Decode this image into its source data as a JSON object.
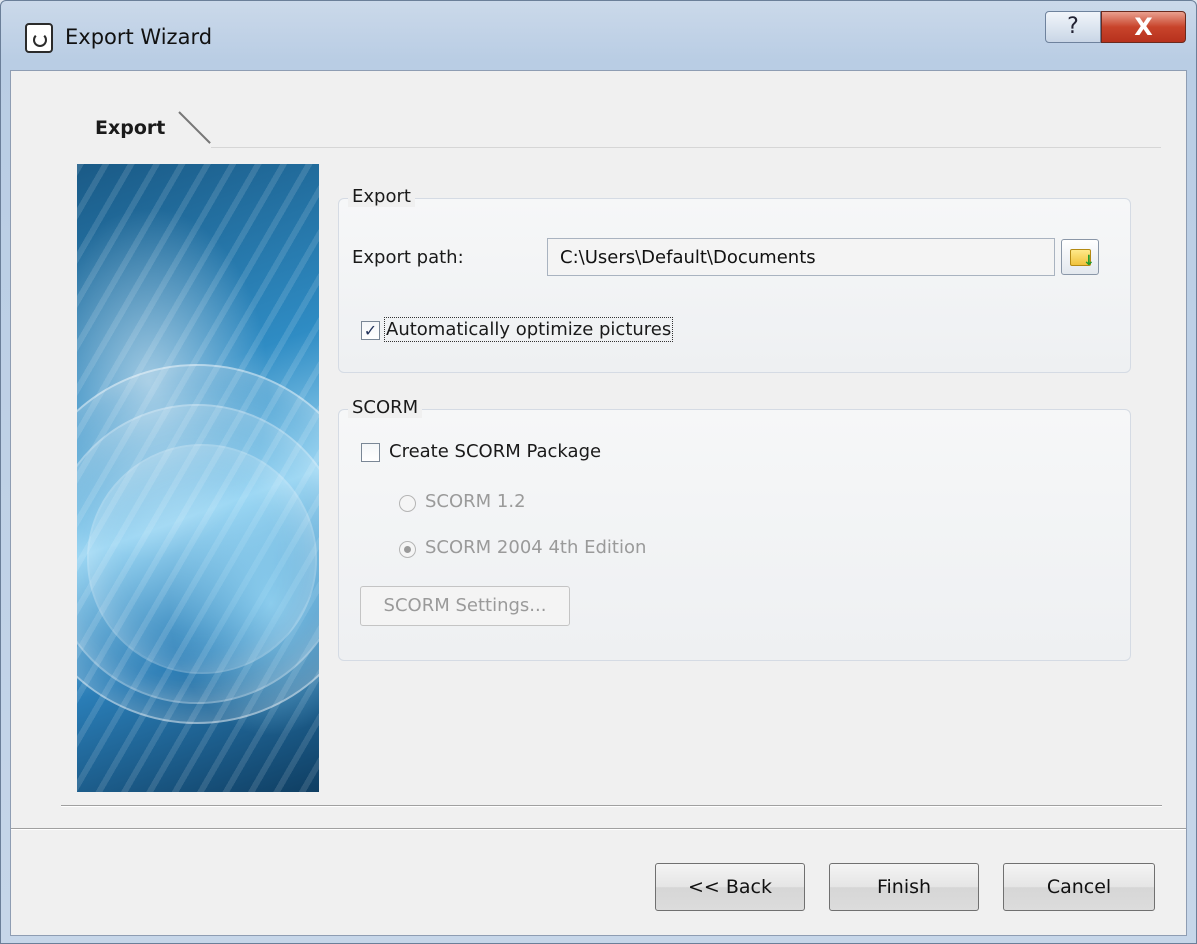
{
  "window": {
    "title": "Export Wizard",
    "help_glyph": "?",
    "close_glyph": "X"
  },
  "tab": {
    "label": "Export"
  },
  "export_group": {
    "legend": "Export",
    "path_label": "Export path:",
    "path_value": "C:\\Users\\Default\\Documents",
    "optimize_label": "Automatically optimize pictures",
    "optimize_checked": true
  },
  "scorm_group": {
    "legend": "SCORM",
    "create_label": "Create SCORM Package",
    "create_checked": false,
    "radio_12_label": "SCORM 1.2",
    "radio_2004_label": "SCORM 2004 4th Edition",
    "selected_version": "SCORM 2004 4th Edition",
    "settings_button": "SCORM Settings..."
  },
  "footer": {
    "back": "<< Back",
    "finish": "Finish",
    "cancel": "Cancel"
  },
  "colors": {
    "close_button": "#c8442b",
    "title_bar": "#b9cde4",
    "dialog_bg": "#f0f0f0"
  }
}
